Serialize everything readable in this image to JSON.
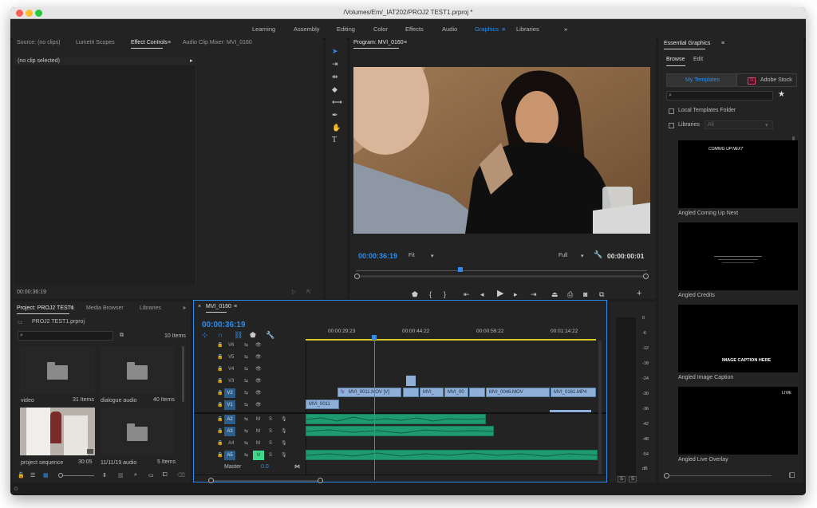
{
  "app": {
    "title": "/Volumes/Em/_IAT202/PROJ2 TEST1.prproj *"
  },
  "workspaces": [
    "Learning",
    "Assembly",
    "Editing",
    "Color",
    "Effects",
    "Audio",
    "Graphics",
    "Libraries"
  ],
  "workspace_active": "Graphics",
  "source_panel": {
    "tabs": [
      "Source: (no clips)",
      "Lumetri Scopes",
      "Effect Controls",
      "Audio Clip Mixer: MVI_0160"
    ],
    "active_tab": "Effect Controls",
    "no_clip": "(no clip selected)",
    "timecode": "00:00:36:19"
  },
  "program": {
    "tab": "Program: MVI_0160",
    "timecode": "00:00:36:19",
    "fit": "Fit",
    "quality": "Full",
    "duration": "00:00:00:01"
  },
  "project": {
    "tabs": [
      "Project: PROJ2 TEST1",
      "Media Browser",
      "Libraries"
    ],
    "file": "PROJ2 TEST1.prproj",
    "item_count": "10 Items",
    "items": [
      {
        "name": "video",
        "meta": "31 Items"
      },
      {
        "name": "dialogue audio",
        "meta": "40 Items"
      },
      {
        "name": "project sequence",
        "meta": "30:05"
      },
      {
        "name": "11/11/19 audio",
        "meta": "5 Items"
      }
    ]
  },
  "timeline": {
    "tab": "MVI_0160",
    "timecode": "00:00:36:19",
    "ruler": [
      "00:00:29:23",
      "00:00:44:22",
      "00:00:59:22",
      "00:01:14:22"
    ],
    "video_tracks": [
      "V6",
      "V5",
      "V4",
      "V3",
      "V2",
      "V1"
    ],
    "audio_tracks": [
      "A2",
      "A3",
      "A4",
      "A5"
    ],
    "master_label": "Master",
    "master_value": "0.0",
    "clips": {
      "v2_a": "fx",
      "v2_b": "MVI_0011.MOV [V]",
      "v2_c": "MVI_",
      "v2_d": "MVI_00",
      "v2_e": "MVI_0046.MOV",
      "v2_f": "MVI_0161.MP4",
      "v1_a": "MVI_0011"
    },
    "track_btn_m": "M",
    "track_btn_s": "S"
  },
  "meter": {
    "scale": [
      "0",
      "-6",
      "-12",
      "-18",
      "-24",
      "-30",
      "-36",
      "-42",
      "-48",
      "-54",
      "dB"
    ],
    "solo": [
      "S",
      "S"
    ]
  },
  "essential_graphics": {
    "title": "Essential Graphics",
    "tabs": [
      "Browse",
      "Edit"
    ],
    "active_tab": "Browse",
    "source_tabs": [
      "My Templates",
      "Adobe Stock"
    ],
    "stock_badge": "St",
    "local_folder": "Local Templates Folder",
    "libraries": "Libraries",
    "libraries_select": "All",
    "templates": [
      {
        "name": "Angled Coming Up Next",
        "overlay": "COMING UP NEXT"
      },
      {
        "name": "Angled Credits",
        "overlay": ""
      },
      {
        "name": "Angled Image Caption",
        "overlay": "IMAGE CAPTION HERE"
      },
      {
        "name": "Angled Live Overlay",
        "overlay": "LIVE"
      }
    ]
  },
  "colors": {
    "accent": "#2d8ceb",
    "clip_video": "#8fb0d8",
    "clip_audio": "#1f9a6f",
    "panel": "#232323"
  }
}
